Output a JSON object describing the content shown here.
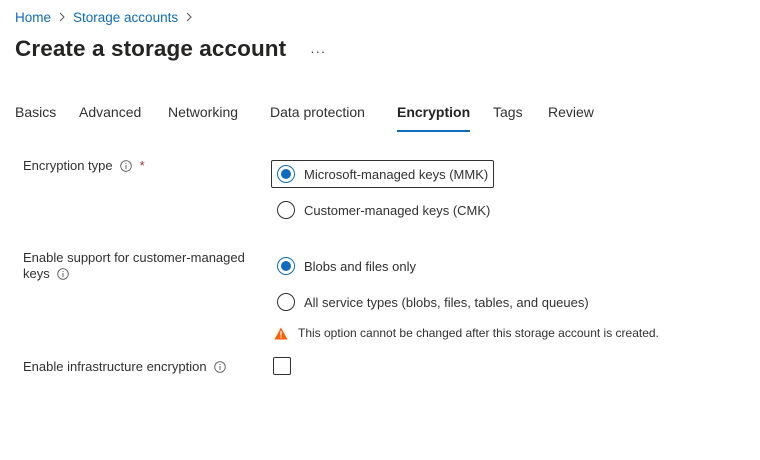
{
  "breadcrumb": {
    "items": [
      "Home",
      "Storage accounts"
    ]
  },
  "header": {
    "title": "Create a storage account",
    "more_icon": "ellipsis-icon",
    "more_glyph": "···"
  },
  "tabs": [
    {
      "label": "Basics",
      "active": false
    },
    {
      "label": "Advanced",
      "active": false
    },
    {
      "label": "Networking",
      "active": false
    },
    {
      "label": "Data protection",
      "active": false
    },
    {
      "label": "Encryption",
      "active": true
    },
    {
      "label": "Tags",
      "active": false
    },
    {
      "label": "Review",
      "active": false
    }
  ],
  "form": {
    "encryption_type": {
      "label": "Encryption type",
      "required_mark": "*",
      "options": [
        {
          "label": "Microsoft-managed keys (MMK)",
          "selected": true
        },
        {
          "label": "Customer-managed keys (CMK)",
          "selected": false
        }
      ]
    },
    "cmk_support": {
      "label_line1": "Enable support for customer-managed",
      "label_line2": "keys",
      "options": [
        {
          "label": "Blobs and files only",
          "selected": true
        },
        {
          "label": "All service types (blobs, files, tables, and queues)",
          "selected": false
        }
      ],
      "warning": "This option cannot be changed after this storage account is created."
    },
    "infrastructure_encryption": {
      "label": "Enable infrastructure encryption",
      "checked": false
    }
  },
  "colors": {
    "accent": "#0f6cbd",
    "required": "#a4262c",
    "warning": "#f7630c",
    "text": "#323130"
  }
}
